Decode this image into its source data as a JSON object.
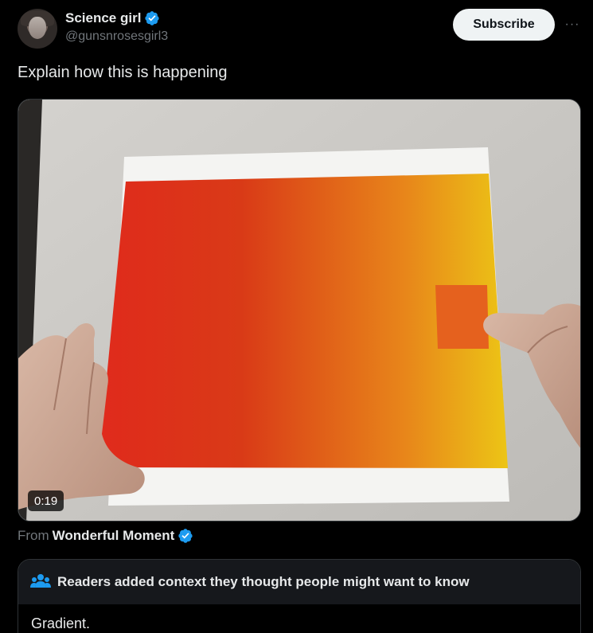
{
  "author": {
    "display_name": "Science girl",
    "handle": "@gunsnrosesgirl3",
    "verified_icon": "verified-badge-icon",
    "avatar_icon": "avatar"
  },
  "actions": {
    "subscribe_label": "Subscribe",
    "more_label": "···"
  },
  "tweet": {
    "text": "Explain how this is happening"
  },
  "video": {
    "duration": "0:19"
  },
  "source": {
    "prefix": "From",
    "name": "Wonderful Moment",
    "verified_icon": "verified-badge-icon"
  },
  "community_note": {
    "icon": "people-icon",
    "title": "Readers added context they thought people might want to know",
    "body": "Gradient."
  },
  "colors": {
    "background": "#000000",
    "text_primary": "#e7e9ea",
    "text_secondary": "#71767b",
    "verified_blue": "#1d9bf0",
    "subscribe_bg": "#eff3f4",
    "note_header_bg": "#16181c",
    "gradient_left": "#e02a1c",
    "gradient_right": "#ecc516",
    "square_color": "#e5611e"
  }
}
